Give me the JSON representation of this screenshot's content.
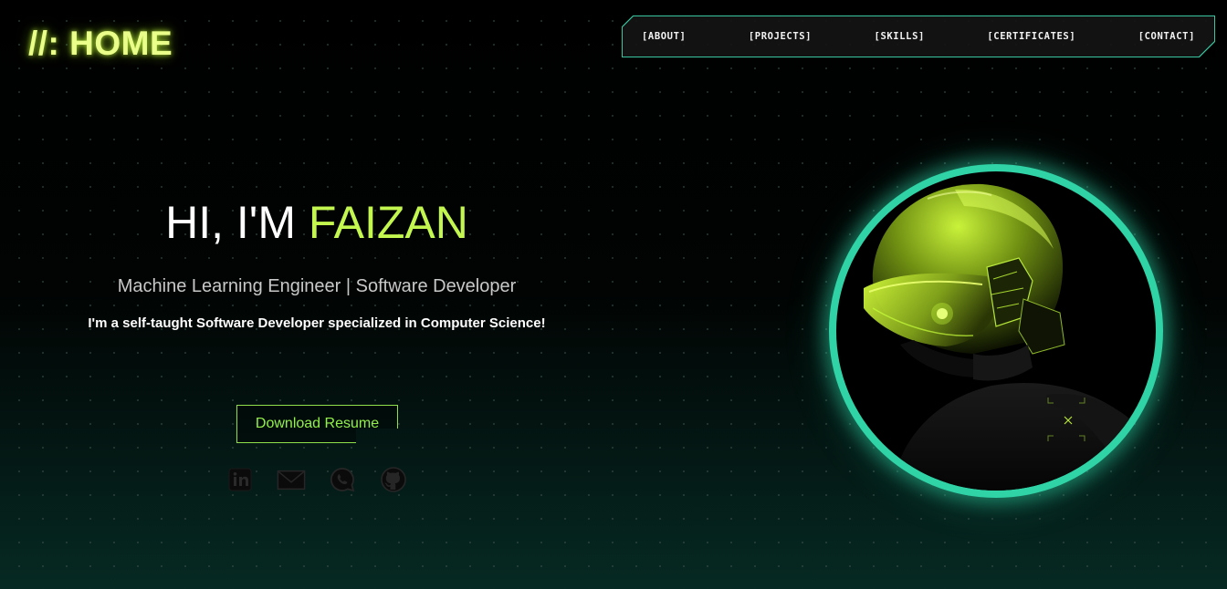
{
  "logo": {
    "text": "//: HOME"
  },
  "nav": {
    "items": [
      {
        "label": "[ABOUT]"
      },
      {
        "label": "[PROJECTS]"
      },
      {
        "label": "[SKILLS]"
      },
      {
        "label": "[CERTIFICATES]"
      },
      {
        "label": "[CONTACT]"
      }
    ]
  },
  "hero": {
    "greeting": "HI, I'M ",
    "name": "FAIZAN",
    "subtitle": "Machine Learning Engineer | Software Developer",
    "description": "I'm a self-taught Software Developer specialized in Computer Science!",
    "download_label": "Download Resume"
  },
  "social": [
    {
      "icon": "linkedin-icon"
    },
    {
      "icon": "mail-icon"
    },
    {
      "icon": "whatsapp-icon"
    },
    {
      "icon": "github-icon"
    }
  ],
  "colors": {
    "accent_lime": "#c3f74f",
    "accent_teal": "#2fd3a6",
    "button_green": "#93f049",
    "logo_glow": "#eaff8a",
    "background": "#000000"
  }
}
